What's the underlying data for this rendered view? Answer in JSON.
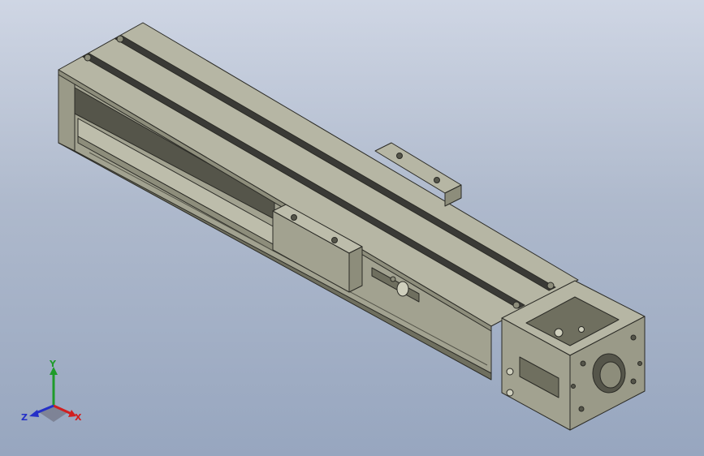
{
  "viewport": {
    "background_top": "#cfd6e4",
    "background_bottom": "#97a6bf"
  },
  "model": {
    "material_color": "#a2a290",
    "top_color": "#b6b6a4",
    "side_color": "#8d8d7b",
    "shadow_color": "#6f6f5f",
    "belt_color": "#3a3a36",
    "edge_color": "#2b2b26"
  },
  "triad": {
    "x_label": "X",
    "y_label": "Y",
    "z_label": "Z",
    "x_color": "#d11f1f",
    "y_color": "#1f9b2a",
    "z_color": "#2430c8"
  }
}
